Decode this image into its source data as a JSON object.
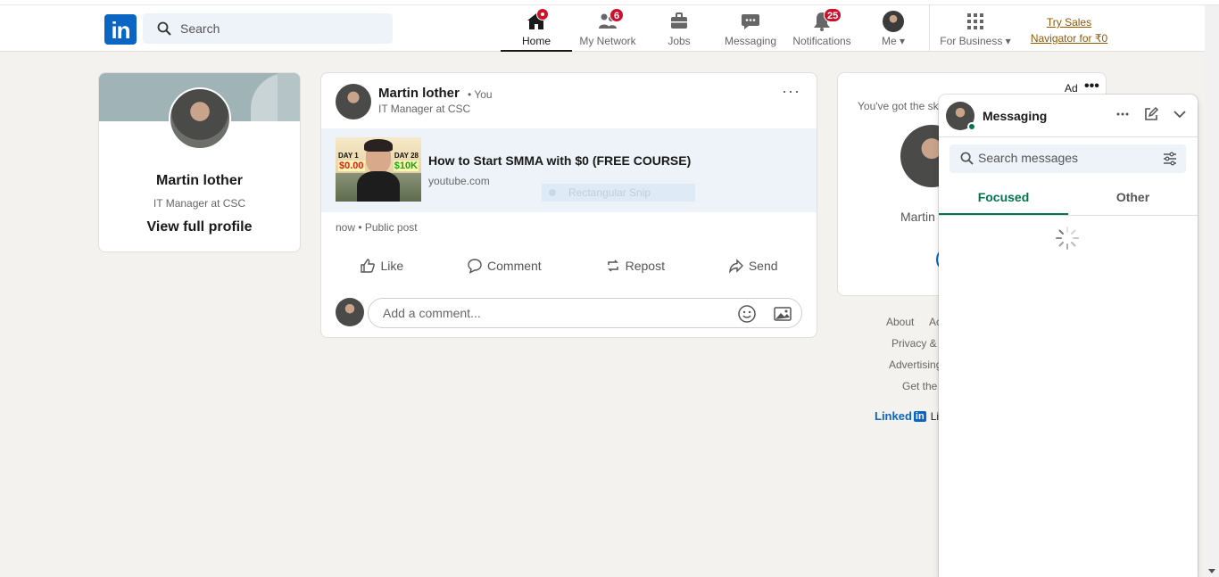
{
  "header": {
    "logo": "in",
    "search_placeholder": "Search",
    "nav": [
      {
        "label": "Home",
        "badge": ""
      },
      {
        "label": "My Network",
        "badge": "6"
      },
      {
        "label": "Jobs",
        "badge": ""
      },
      {
        "label": "Messaging",
        "badge": ""
      },
      {
        "label": "Notifications",
        "badge": "25"
      },
      {
        "label": "Me",
        "badge": ""
      },
      {
        "label": "For Business",
        "badge": ""
      }
    ],
    "try_sales_line1": "Try Sales",
    "try_sales_line2": "Navigator for ₹0"
  },
  "profile": {
    "name": "Martin lother",
    "title": "IT Manager at CSC",
    "link": "View full profile"
  },
  "post": {
    "author": "Martin lother",
    "you": "• You",
    "subtitle": "IT Manager at CSC",
    "more": "···",
    "link_title": "How to Start SMMA with $0 (FREE COURSE)",
    "link_domain": "youtube.com",
    "thumb_day1": "DAY 1",
    "thumb_amount1": "$0.00",
    "thumb_day2": "DAY 28",
    "thumb_amount2": "$10K",
    "snip_overlay": "Rectangular Snip",
    "meta": "now • Public post",
    "actions": [
      "Like",
      "Comment",
      "Repost",
      "Send"
    ],
    "comment_placeholder": "Add a comment..."
  },
  "ad": {
    "label": "Ad",
    "more": "•••",
    "text": "You've got the ski",
    "name": "Martin"
  },
  "footer": {
    "links": [
      "About",
      "Ac",
      "Privacy &",
      "Advertising",
      "Get the"
    ],
    "brand": "Linked",
    "brand_in": "in",
    "brand_tail": "Lin"
  },
  "messaging": {
    "title": "Messaging",
    "search_placeholder": "Search messages",
    "tabs": [
      "Focused",
      "Other"
    ]
  },
  "colors": {
    "brand": "#0a66c2",
    "badge": "#cb112d",
    "messaging_accent": "#01754f",
    "premium_link": "#915907"
  }
}
